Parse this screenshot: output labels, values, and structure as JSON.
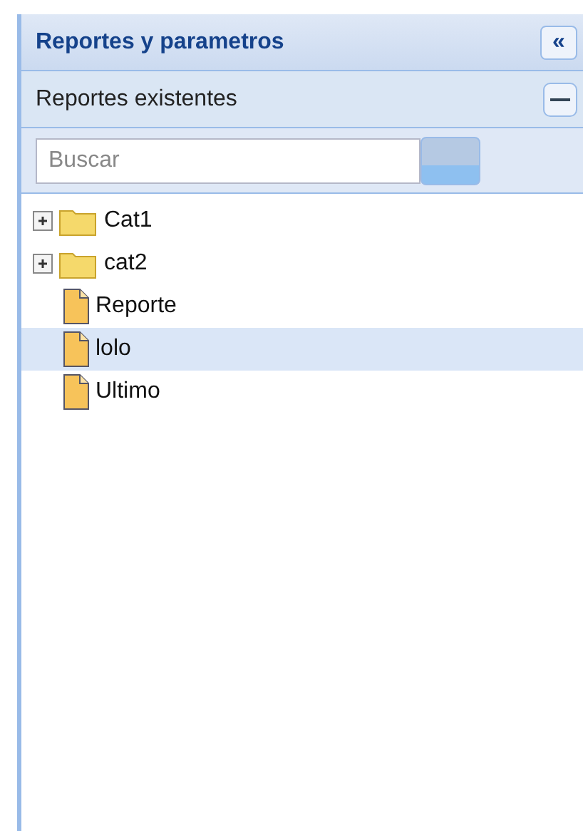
{
  "panel": {
    "title": "Reportes y parametros",
    "collapse_button": "«"
  },
  "section": {
    "title": "Reportes existentes"
  },
  "search": {
    "placeholder": "Buscar"
  },
  "tree": [
    {
      "kind": "folder",
      "label": "Cat1",
      "expanded": false,
      "selected": false
    },
    {
      "kind": "folder",
      "label": "cat2",
      "expanded": false,
      "selected": false
    },
    {
      "kind": "report",
      "label": "Reporte",
      "selected": false
    },
    {
      "kind": "report",
      "label": "lolo",
      "selected": true
    },
    {
      "kind": "report",
      "label": "Ultimo",
      "selected": false
    }
  ]
}
